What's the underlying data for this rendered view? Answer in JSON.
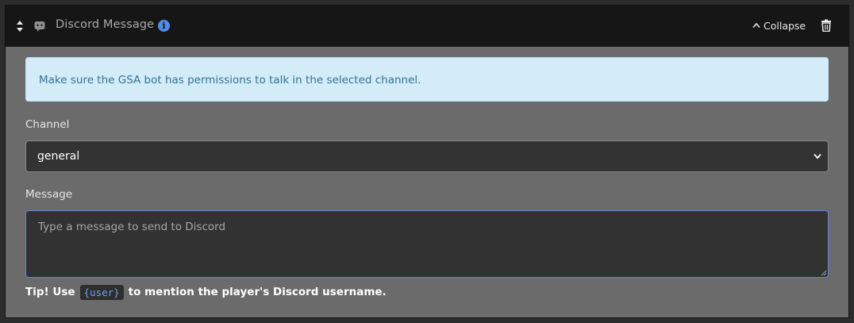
{
  "header": {
    "title": "Discord Message",
    "collapse_label": "Collapse",
    "icons": {
      "drag": "sort-icon",
      "type": "discord-icon",
      "info": "info-icon",
      "collapse": "chevron-up-icon",
      "delete": "trash-icon"
    },
    "info_glyph": "i"
  },
  "alert": {
    "text": "Make sure the GSA bot has permissions to talk in the selected channel."
  },
  "channel": {
    "label": "Channel",
    "selected": "general"
  },
  "message": {
    "label": "Message",
    "value": "",
    "placeholder": "Type a message to send to Discord"
  },
  "tip": {
    "prefix": "Tip! Use",
    "code": "{user}",
    "suffix": "to mention the player's Discord username."
  },
  "colors": {
    "header_bg": "#161616",
    "body_bg": "#6b6b6b",
    "accent": "#4f8de8",
    "alert_bg": "#d3ecf7",
    "alert_text": "#2f7494"
  }
}
